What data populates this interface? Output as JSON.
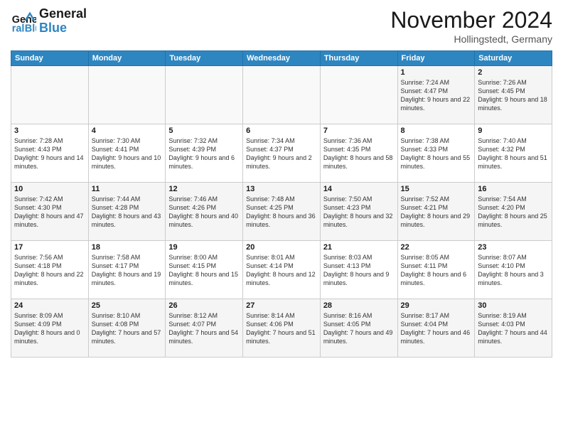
{
  "header": {
    "logo_line1": "General",
    "logo_line2": "Blue",
    "month_title": "November 2024",
    "location": "Hollingstedt, Germany"
  },
  "weekdays": [
    "Sunday",
    "Monday",
    "Tuesday",
    "Wednesday",
    "Thursday",
    "Friday",
    "Saturday"
  ],
  "weeks": [
    [
      {
        "day": "",
        "info": ""
      },
      {
        "day": "",
        "info": ""
      },
      {
        "day": "",
        "info": ""
      },
      {
        "day": "",
        "info": ""
      },
      {
        "day": "",
        "info": ""
      },
      {
        "day": "1",
        "info": "Sunrise: 7:24 AM\nSunset: 4:47 PM\nDaylight: 9 hours and 22 minutes."
      },
      {
        "day": "2",
        "info": "Sunrise: 7:26 AM\nSunset: 4:45 PM\nDaylight: 9 hours and 18 minutes."
      }
    ],
    [
      {
        "day": "3",
        "info": "Sunrise: 7:28 AM\nSunset: 4:43 PM\nDaylight: 9 hours and 14 minutes."
      },
      {
        "day": "4",
        "info": "Sunrise: 7:30 AM\nSunset: 4:41 PM\nDaylight: 9 hours and 10 minutes."
      },
      {
        "day": "5",
        "info": "Sunrise: 7:32 AM\nSunset: 4:39 PM\nDaylight: 9 hours and 6 minutes."
      },
      {
        "day": "6",
        "info": "Sunrise: 7:34 AM\nSunset: 4:37 PM\nDaylight: 9 hours and 2 minutes."
      },
      {
        "day": "7",
        "info": "Sunrise: 7:36 AM\nSunset: 4:35 PM\nDaylight: 8 hours and 58 minutes."
      },
      {
        "day": "8",
        "info": "Sunrise: 7:38 AM\nSunset: 4:33 PM\nDaylight: 8 hours and 55 minutes."
      },
      {
        "day": "9",
        "info": "Sunrise: 7:40 AM\nSunset: 4:32 PM\nDaylight: 8 hours and 51 minutes."
      }
    ],
    [
      {
        "day": "10",
        "info": "Sunrise: 7:42 AM\nSunset: 4:30 PM\nDaylight: 8 hours and 47 minutes."
      },
      {
        "day": "11",
        "info": "Sunrise: 7:44 AM\nSunset: 4:28 PM\nDaylight: 8 hours and 43 minutes."
      },
      {
        "day": "12",
        "info": "Sunrise: 7:46 AM\nSunset: 4:26 PM\nDaylight: 8 hours and 40 minutes."
      },
      {
        "day": "13",
        "info": "Sunrise: 7:48 AM\nSunset: 4:25 PM\nDaylight: 8 hours and 36 minutes."
      },
      {
        "day": "14",
        "info": "Sunrise: 7:50 AM\nSunset: 4:23 PM\nDaylight: 8 hours and 32 minutes."
      },
      {
        "day": "15",
        "info": "Sunrise: 7:52 AM\nSunset: 4:21 PM\nDaylight: 8 hours and 29 minutes."
      },
      {
        "day": "16",
        "info": "Sunrise: 7:54 AM\nSunset: 4:20 PM\nDaylight: 8 hours and 25 minutes."
      }
    ],
    [
      {
        "day": "17",
        "info": "Sunrise: 7:56 AM\nSunset: 4:18 PM\nDaylight: 8 hours and 22 minutes."
      },
      {
        "day": "18",
        "info": "Sunrise: 7:58 AM\nSunset: 4:17 PM\nDaylight: 8 hours and 19 minutes."
      },
      {
        "day": "19",
        "info": "Sunrise: 8:00 AM\nSunset: 4:15 PM\nDaylight: 8 hours and 15 minutes."
      },
      {
        "day": "20",
        "info": "Sunrise: 8:01 AM\nSunset: 4:14 PM\nDaylight: 8 hours and 12 minutes."
      },
      {
        "day": "21",
        "info": "Sunrise: 8:03 AM\nSunset: 4:13 PM\nDaylight: 8 hours and 9 minutes."
      },
      {
        "day": "22",
        "info": "Sunrise: 8:05 AM\nSunset: 4:11 PM\nDaylight: 8 hours and 6 minutes."
      },
      {
        "day": "23",
        "info": "Sunrise: 8:07 AM\nSunset: 4:10 PM\nDaylight: 8 hours and 3 minutes."
      }
    ],
    [
      {
        "day": "24",
        "info": "Sunrise: 8:09 AM\nSunset: 4:09 PM\nDaylight: 8 hours and 0 minutes."
      },
      {
        "day": "25",
        "info": "Sunrise: 8:10 AM\nSunset: 4:08 PM\nDaylight: 7 hours and 57 minutes."
      },
      {
        "day": "26",
        "info": "Sunrise: 8:12 AM\nSunset: 4:07 PM\nDaylight: 7 hours and 54 minutes."
      },
      {
        "day": "27",
        "info": "Sunrise: 8:14 AM\nSunset: 4:06 PM\nDaylight: 7 hours and 51 minutes."
      },
      {
        "day": "28",
        "info": "Sunrise: 8:16 AM\nSunset: 4:05 PM\nDaylight: 7 hours and 49 minutes."
      },
      {
        "day": "29",
        "info": "Sunrise: 8:17 AM\nSunset: 4:04 PM\nDaylight: 7 hours and 46 minutes."
      },
      {
        "day": "30",
        "info": "Sunrise: 8:19 AM\nSunset: 4:03 PM\nDaylight: 7 hours and 44 minutes."
      }
    ]
  ]
}
